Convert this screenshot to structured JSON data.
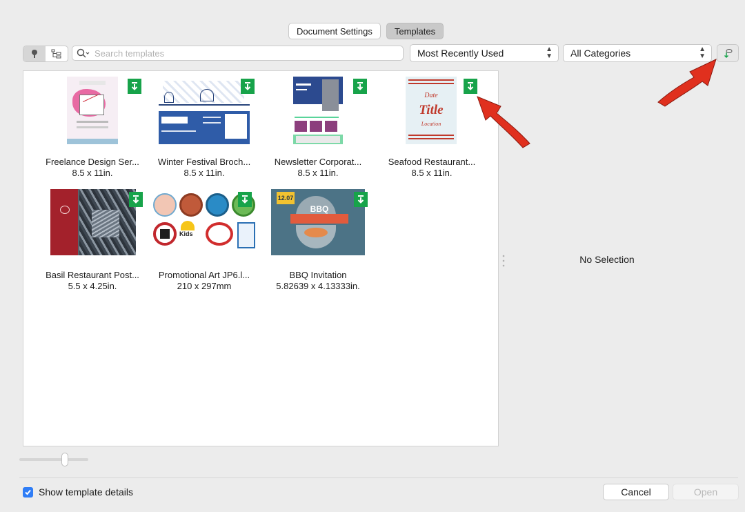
{
  "tabs": {
    "document_settings": "Document Settings",
    "templates": "Templates"
  },
  "toolbar": {
    "search_placeholder": "Search templates",
    "sort_value": "Most Recently Used",
    "category_value": "All Categories"
  },
  "templates": [
    {
      "name": "Freelance Design Ser...",
      "size": "8.5 x 11in."
    },
    {
      "name": "Winter Festival Broch...",
      "size": "8.5 x 11in."
    },
    {
      "name": "Newsletter Corporat...",
      "size": "8.5 x 11in."
    },
    {
      "name": "Seafood Restaurant...",
      "size": "8.5 x 11in."
    },
    {
      "name": "Basil Restaurant Post...",
      "size": "5.5 x 4.25in."
    },
    {
      "name": "Promotional Art JP6.l...",
      "size": "210 x 297mm"
    },
    {
      "name": "BBQ Invitation",
      "size": "5.82639 x 4.13333in."
    }
  ],
  "thumb_text": {
    "seafood_date": "Date",
    "seafood_title": "Title",
    "seafood_location": "Location",
    "bbq_banner": "BBQ",
    "bbq_date": "12.07",
    "promo_kids": "Kids"
  },
  "details": {
    "no_selection": "No Selection"
  },
  "footer": {
    "show_details": "Show template details",
    "cancel": "Cancel",
    "open": "Open"
  },
  "colors": {
    "download_badge": "#17a34a",
    "annotation_arrow": "#e0301e",
    "checkbox": "#2f7df6"
  }
}
